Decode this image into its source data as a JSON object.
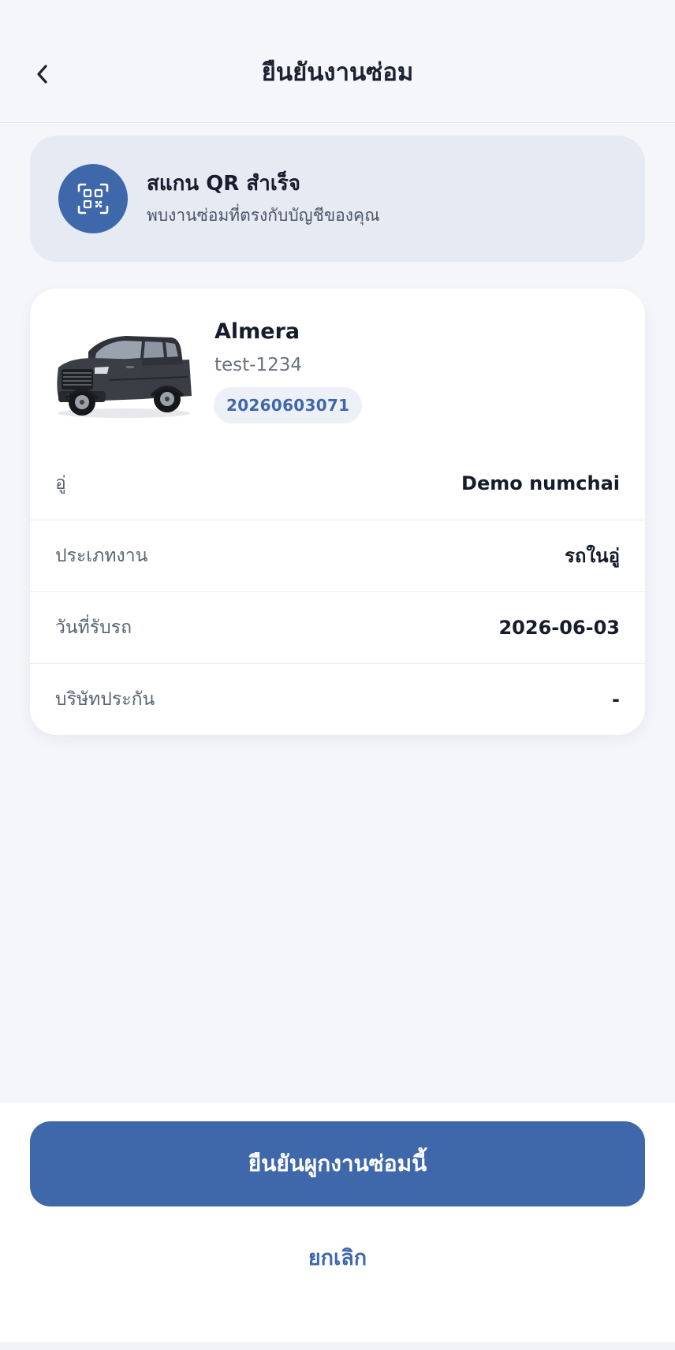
{
  "header": {
    "title": "ยืนยันงานซ่อม",
    "back_icon": "chevron-left-icon"
  },
  "scan_result": {
    "icon": "qr-scan-icon",
    "title": "สแกน QR สำเร็จ",
    "subtitle": "พบงานซ่อมที่ตรงกับบัญชีของคุณ"
  },
  "job": {
    "car_name": "Almera",
    "plate": "test-1234",
    "job_number": "20260603071",
    "details": [
      {
        "label": "อู่",
        "value": "Demo numchai"
      },
      {
        "label": "ประเภทงาน",
        "value": "รถในอู่"
      },
      {
        "label": "วันที่รับรถ",
        "value": "2026-06-03"
      },
      {
        "label": "บริษัทประกัน",
        "value": "-"
      }
    ]
  },
  "actions": {
    "confirm_label": "ยืนยันผูกงานซ่อมนี้",
    "cancel_label": "ยกเลิก"
  },
  "colors": {
    "primary": "#3f68ab",
    "background": "#f4f6fa",
    "scan_card_bg": "#e5eaf3",
    "card_bg": "#ffffff",
    "text_dark": "#161c2b",
    "text_muted": "#5b6472"
  }
}
